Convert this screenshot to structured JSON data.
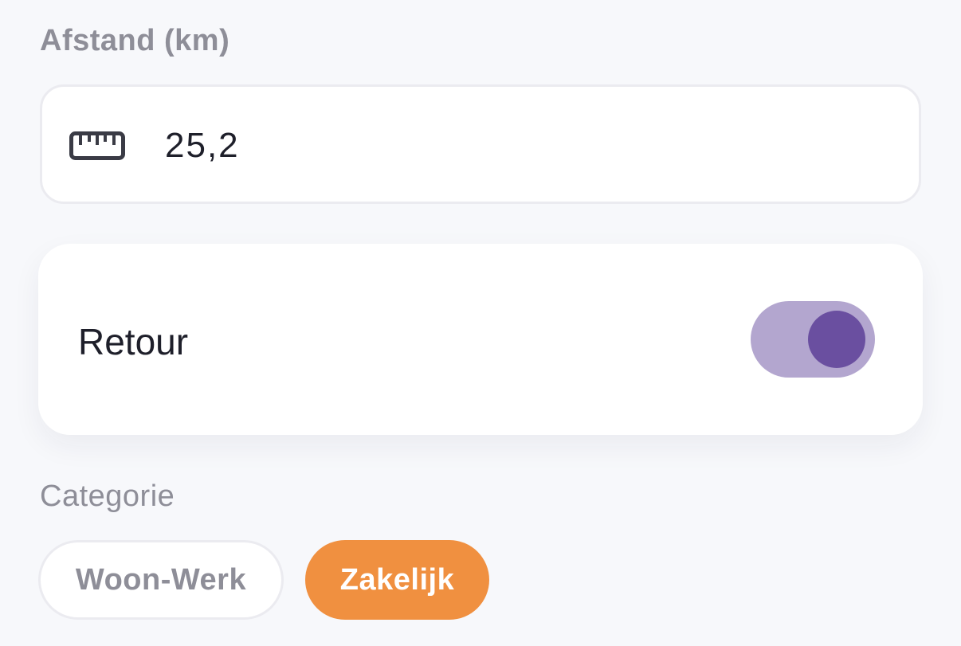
{
  "distance": {
    "label": "Afstand (km)",
    "icon": "ruler-icon",
    "value": "25,2"
  },
  "return_trip": {
    "label": "Retour",
    "enabled": true,
    "colors": {
      "track": "#b3a6cf",
      "knob": "#6a4fa0"
    }
  },
  "category": {
    "label": "Categorie",
    "options": [
      {
        "label": "Woon-Werk",
        "selected": false
      },
      {
        "label": "Zakelijk",
        "selected": true
      }
    ],
    "colors": {
      "selected": "#f09040",
      "unselected_text": "#8e8e98"
    }
  }
}
